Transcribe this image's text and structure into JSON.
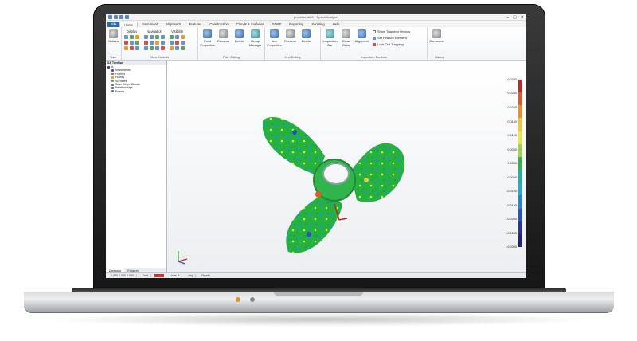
{
  "app": {
    "title": "propeller.xit64 - SpatialAnalyzer",
    "window_controls": [
      "–",
      "▢",
      "✕"
    ]
  },
  "tabs": [
    {
      "label": "File",
      "active": false
    },
    {
      "label": "Home",
      "active": true
    },
    {
      "label": "Instrument",
      "active": false
    },
    {
      "label": "Alignment",
      "active": false
    },
    {
      "label": "Features",
      "active": false
    },
    {
      "label": "Construction",
      "active": false
    },
    {
      "label": "Clouds & Surfaces",
      "active": false
    },
    {
      "label": "GD&T",
      "active": false
    },
    {
      "label": "Reporting",
      "active": false
    },
    {
      "label": "Scripting",
      "active": false
    },
    {
      "label": "Help",
      "active": false
    }
  ],
  "ribbon": {
    "user": {
      "group": "User",
      "options": "Options"
    },
    "view_controls": {
      "group": "View Controls",
      "display": "Display",
      "navigation": "Navigation",
      "visibility": "Visibility"
    },
    "point_editing": {
      "group": "Point Editing",
      "point_properties": "Point Properties",
      "rename": "Rename",
      "delete": "Delete",
      "group_manager": "Group Manager"
    },
    "item_editing": {
      "group": "Item Editing",
      "item_properties": "Item Properties",
      "rename": "Rename",
      "delete": "Delete"
    },
    "inspection": {
      "group": "Inspection Controls",
      "inspection_bar": "Inspection Bar",
      "clear_data": "Clear Data",
      "alignment": "Alignment",
      "show_trapping_vectors": "Show Trapping Vectors",
      "set_feature_element": "Set Feature Element",
      "lock_out_trapping": "Lock Out Trapping"
    },
    "history": {
      "group": "History",
      "command": "Command"
    }
  },
  "tree": {
    "header": "SA TreeBar",
    "items": [
      {
        "label": "A",
        "color": "#444444",
        "indent": 0
      },
      {
        "label": "Instruments",
        "color": "#2f66b0",
        "indent": 1
      },
      {
        "label": "Frames",
        "color": "#d1534b",
        "indent": 1
      },
      {
        "label": "Planes",
        "color": "#e0a030",
        "indent": 1
      },
      {
        "label": "Surfaces",
        "color": "#5aa75a",
        "indent": 1
      },
      {
        "label": "Scan Stripe Clouds",
        "color": "#8a5fb8",
        "indent": 1
      },
      {
        "label": "Relationships",
        "color": "#2f8a96",
        "indent": 1
      },
      {
        "label": "Events",
        "color": "#777777",
        "indent": 1
      }
    ],
    "bottom_tabs": [
      "Database",
      "Explorer"
    ]
  },
  "color_scale": {
    "labels": [
      "0.0300",
      "0.0250",
      "0.0200",
      "0.0150",
      "0.0100",
      "0.0050",
      "0.0000",
      "-0.0050",
      "-0.0100",
      "-0.0150",
      "-0.0200",
      "-0.0250",
      "-0.0300"
    ],
    "colors": [
      "#c4271f",
      "#e1582a",
      "#f28a2e",
      "#f6c43b",
      "#e7e64a",
      "#9ad84a",
      "#2fb54a",
      "#21b0a2",
      "#2aa6e0",
      "#2a7fdc",
      "#2552c8",
      "#2434a7",
      "#23207e"
    ]
  },
  "statusbar": {
    "cells": [
      "0.000 0.000 0.000",
      "Feet",
      "Units: ft",
      "deg",
      "Ready"
    ]
  }
}
